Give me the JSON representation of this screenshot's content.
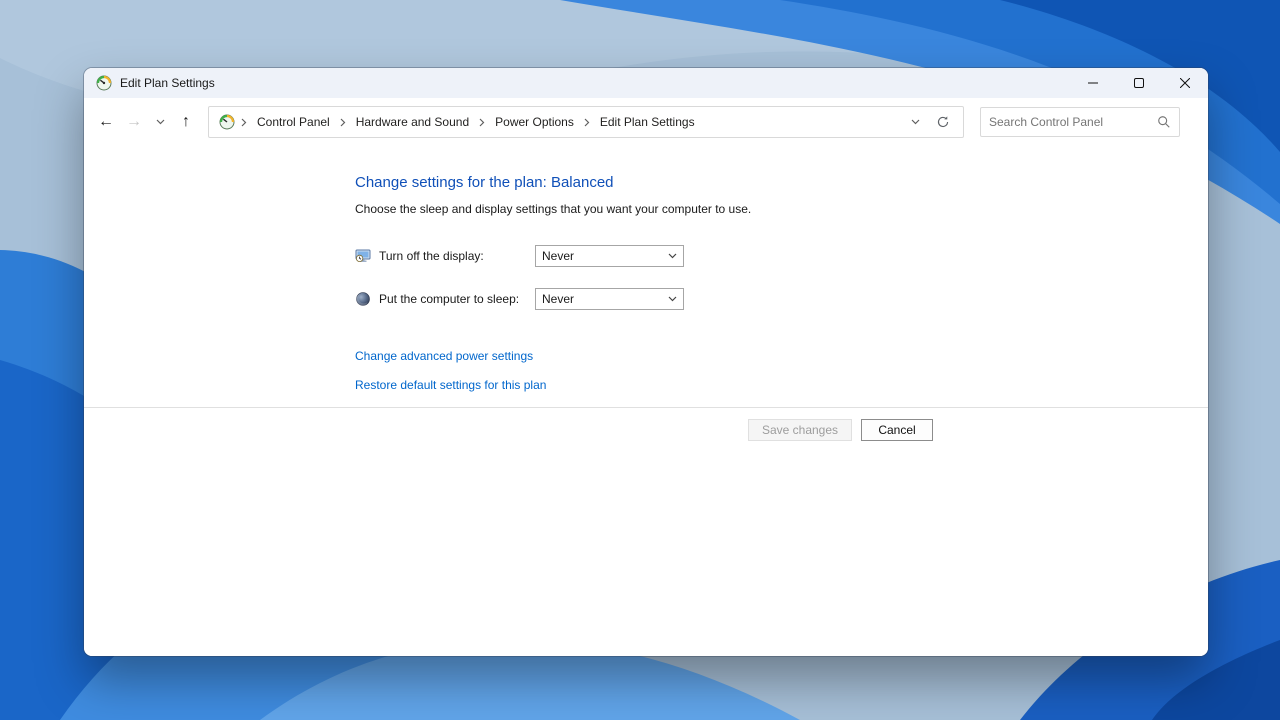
{
  "window": {
    "title": "Edit Plan Settings"
  },
  "toolbar": {
    "breadcrumb": {
      "items": [
        "Control Panel",
        "Hardware and Sound",
        "Power Options",
        "Edit Plan Settings"
      ]
    },
    "search": {
      "placeholder": "Search Control Panel"
    }
  },
  "content": {
    "heading": "Change settings for the plan: Balanced",
    "subheading": "Choose the sleep and display settings that you want your computer to use.",
    "settings": [
      {
        "label": "Turn off the display:",
        "value": "Never",
        "icon": "display-clock-icon"
      },
      {
        "label": "Put the computer to sleep:",
        "value": "Never",
        "icon": "sleep-moon-icon"
      }
    ],
    "links": [
      "Change advanced power settings",
      "Restore default settings for this plan"
    ]
  },
  "footer": {
    "save_label": "Save changes",
    "cancel_label": "Cancel"
  },
  "colors": {
    "heading_blue": "#1050b8",
    "link_blue": "#0066cc",
    "titlebar": "#eef2f9",
    "wallpaper_base": "#a7c0d8",
    "wallpaper_accent": "#1a66c8"
  }
}
